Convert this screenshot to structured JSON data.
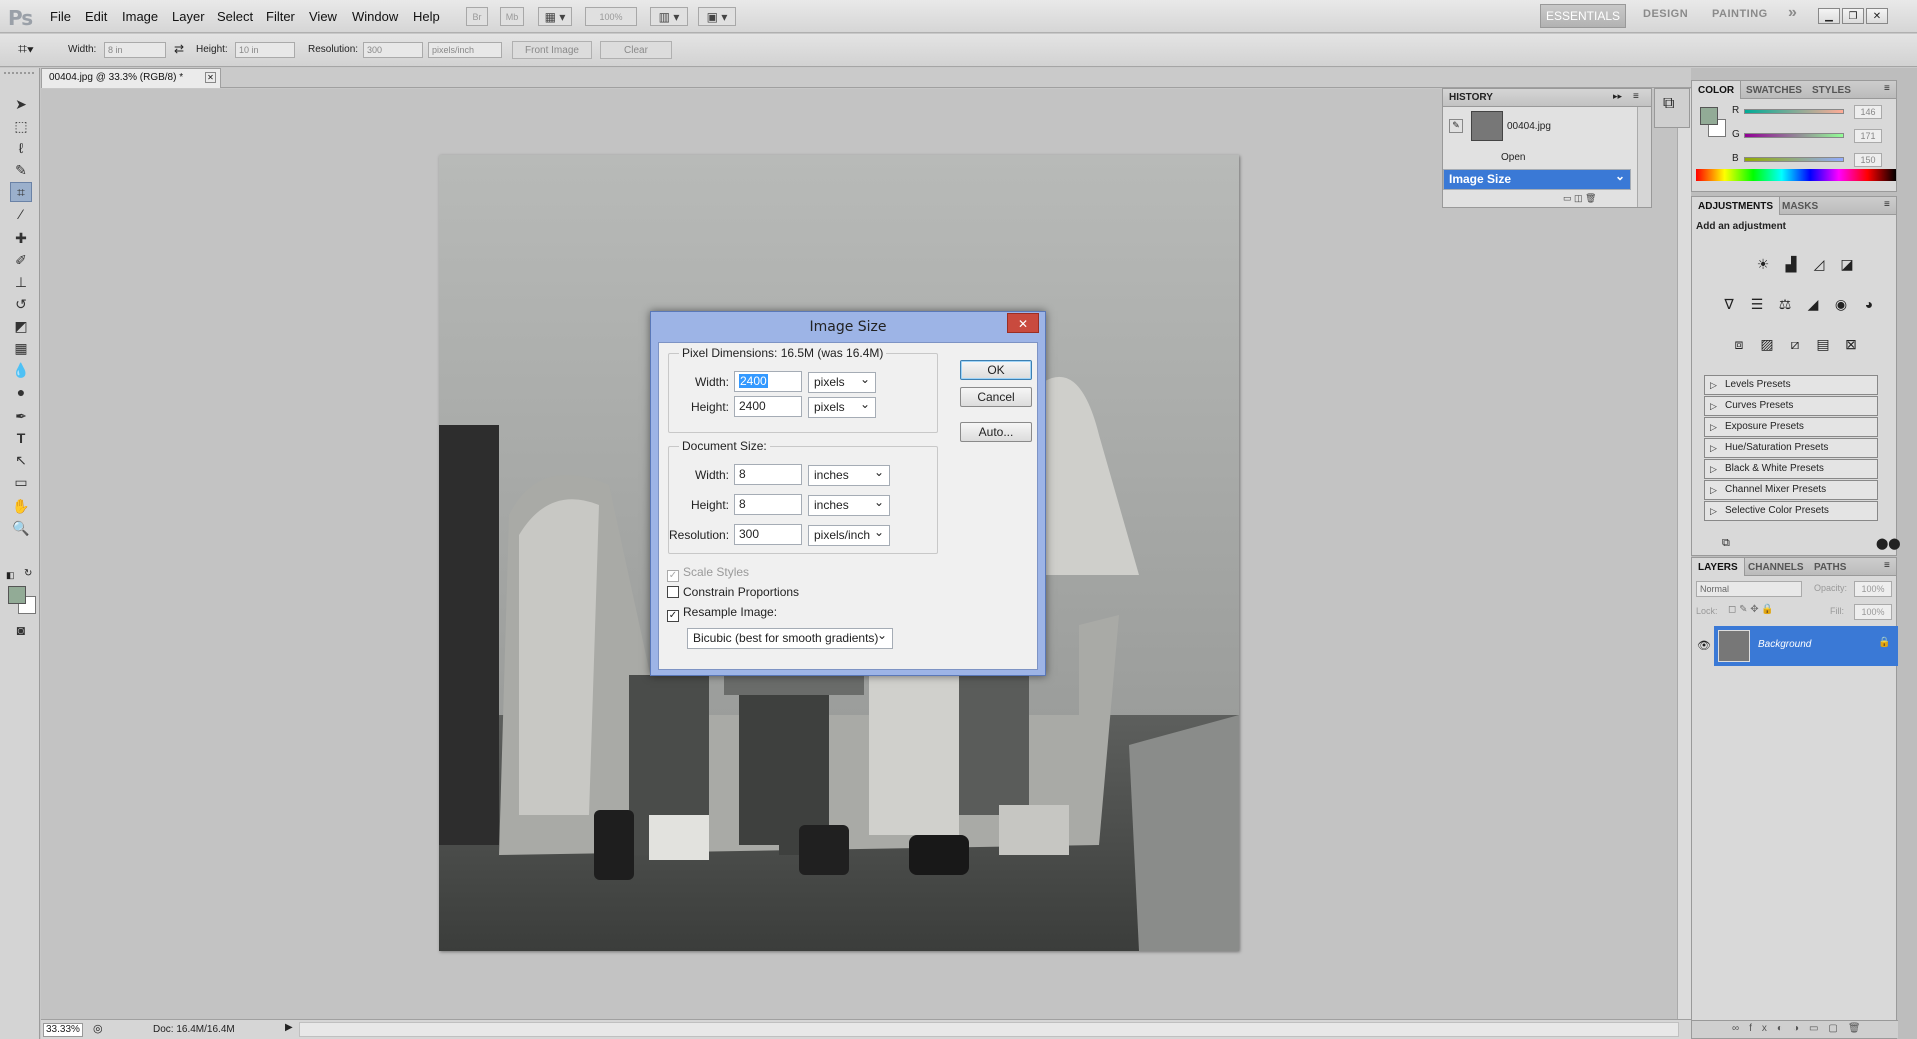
{
  "app": {
    "logo": "Ps"
  },
  "menu": [
    "File",
    "Edit",
    "Image",
    "Layer",
    "Select",
    "Filter",
    "View",
    "Window",
    "Help"
  ],
  "menubar_buttons": {
    "br": "Br",
    "mb": "Mb",
    "zoom": "100%"
  },
  "workspaces": {
    "essentials": "ESSENTIALS",
    "design": "DESIGN",
    "painting": "PAINTING",
    "more": "»"
  },
  "options": {
    "width_label": "Width:",
    "width_value": "8 in",
    "height_label": "Height:",
    "height_value": "10 in",
    "resolution_label": "Resolution:",
    "resolution_value": "300",
    "resolution_unit": "pixels/inch",
    "front_image": "Front Image",
    "clear": "Clear"
  },
  "document": {
    "tab_title": "00404.jpg @ 33.3% (RGB/8) *",
    "zoom": "33.33%",
    "doc_info": "Doc: 16.4M/16.4M"
  },
  "history": {
    "title": "HISTORY",
    "snapshot": "00404.jpg",
    "items": [
      {
        "label": "Open"
      },
      {
        "label": "Image Size"
      }
    ]
  },
  "color_panel": {
    "tabs": [
      "COLOR",
      "SWATCHES",
      "STYLES"
    ],
    "r_label": "R",
    "g_label": "G",
    "b_label": "B",
    "r": "146",
    "g": "171",
    "b": "150",
    "foreground": "#92ab96"
  },
  "adjustments": {
    "tabs": [
      "ADJUSTMENTS",
      "MASKS"
    ],
    "heading": "Add an adjustment",
    "presets": [
      "Levels Presets",
      "Curves Presets",
      "Exposure Presets",
      "Hue/Saturation Presets",
      "Black & White Presets",
      "Channel Mixer Presets",
      "Selective Color Presets"
    ]
  },
  "layers": {
    "tabs": [
      "LAYERS",
      "CHANNELS",
      "PATHS"
    ],
    "blend_mode": "Normal",
    "opacity_label": "Opacity:",
    "opacity": "100%",
    "lock_label": "Lock:",
    "fill_label": "Fill:",
    "fill": "100%",
    "layer_name": "Background"
  },
  "dialog": {
    "title": "Image Size",
    "close": "✕",
    "pixel_dimensions": "Pixel Dimensions:  16.5M (was 16.4M)",
    "px_width_label": "Width:",
    "px_width": "2400",
    "px_width_unit": "pixels",
    "px_height_label": "Height:",
    "px_height": "2400",
    "px_height_unit": "pixels",
    "document_size": "Document Size:",
    "doc_width_label": "Width:",
    "doc_width": "8",
    "doc_width_unit": "inches",
    "doc_height_label": "Height:",
    "doc_height": "8",
    "doc_height_unit": "inches",
    "resolution_label": "Resolution:",
    "resolution": "300",
    "resolution_unit": "pixels/inch",
    "scale_styles": "Scale Styles",
    "constrain": "Constrain Proportions",
    "resample": "Resample Image:",
    "resample_method": "Bicubic (best for smooth gradients)",
    "ok": "OK",
    "cancel": "Cancel",
    "auto": "Auto..."
  }
}
